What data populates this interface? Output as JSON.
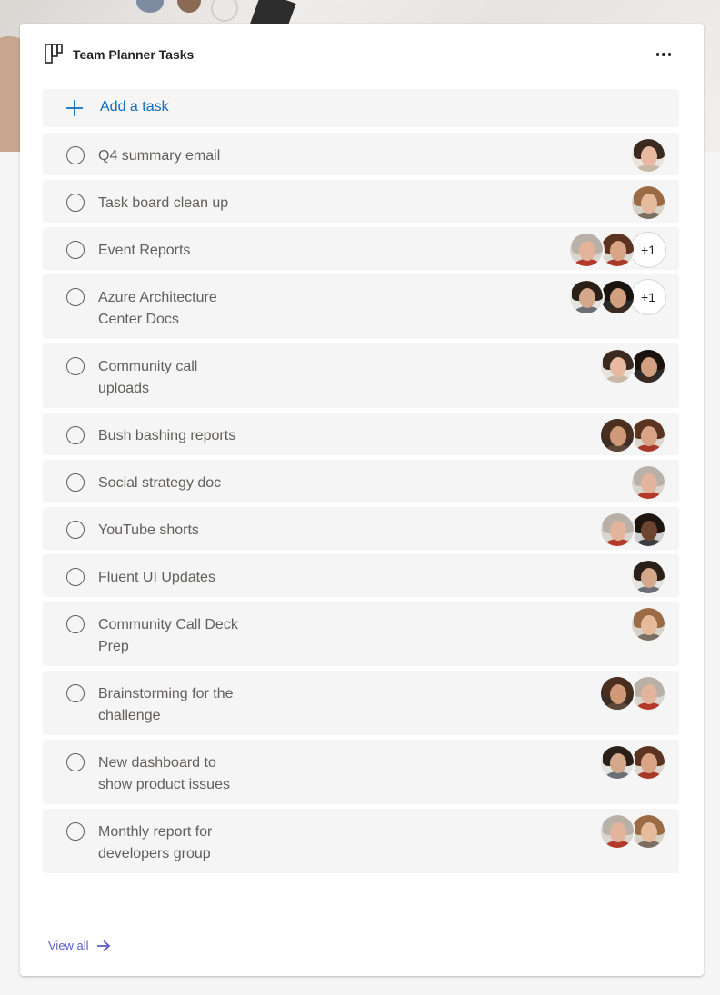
{
  "card": {
    "title": "Team Planner Tasks",
    "add_task_label": "Add a task",
    "view_all_label": "View all",
    "icons": {
      "app": "planner-board-icon",
      "more": "more-options-icon",
      "add": "plus-icon",
      "view_all": "arrow-right-icon"
    }
  },
  "colors": {
    "accent_blue": "#0f6cbd",
    "link_purple": "#5b5fc7",
    "row_bg": "#f5f5f5",
    "text_gray": "#605e5c"
  },
  "tasks": [
    {
      "title": "Q4 summary email",
      "assignees": [
        "a1"
      ],
      "overflow": ""
    },
    {
      "title": "Task board clean up",
      "assignees": [
        "a2"
      ],
      "overflow": ""
    },
    {
      "title": "Event Reports",
      "assignees": [
        "a3",
        "a4"
      ],
      "overflow": "+1"
    },
    {
      "title": "Azure Architecture Center Docs",
      "assignees": [
        "a5",
        "a6"
      ],
      "overflow": "+1"
    },
    {
      "title": "Community call uploads",
      "assignees": [
        "a1",
        "a6"
      ],
      "overflow": ""
    },
    {
      "title": "Bush bashing reports",
      "assignees": [
        "a7",
        "a4"
      ],
      "overflow": ""
    },
    {
      "title": "Social strategy doc",
      "assignees": [
        "a3"
      ],
      "overflow": ""
    },
    {
      "title": "YouTube shorts",
      "assignees": [
        "a3",
        "a8"
      ],
      "overflow": ""
    },
    {
      "title": "Fluent UI Updates",
      "assignees": [
        "a5"
      ],
      "overflow": ""
    },
    {
      "title": "Community Call Deck Prep",
      "assignees": [
        "a2"
      ],
      "overflow": ""
    },
    {
      "title": "Brainstorming for the challenge",
      "assignees": [
        "a7",
        "a3"
      ],
      "overflow": ""
    },
    {
      "title": "New dashboard to show product issues",
      "assignees": [
        "a5",
        "a4"
      ],
      "overflow": ""
    },
    {
      "title": "Monthly report for developers group",
      "assignees": [
        "a3",
        "a2"
      ],
      "overflow": ""
    }
  ],
  "avatar_palettes": {
    "a1": {
      "bg": "#e9e4df",
      "hair": "#3b2a20",
      "face": "#e8b9a0",
      "body": "#c9b8a8"
    },
    "a2": {
      "bg": "#d8d2c6",
      "hair": "#9a6b45",
      "face": "#e5bb9c",
      "body": "#7a6f62"
    },
    "a3": {
      "bg": "#d9d5cf",
      "hair": "#b9b0a8",
      "face": "#e2b49b",
      "body": "#b33a2a"
    },
    "a4": {
      "bg": "#dcd7cf",
      "hair": "#5a3420",
      "face": "#d9a485",
      "body": "#a83a2c"
    },
    "a5": {
      "bg": "#e3e3df",
      "hair": "#2b2018",
      "face": "#d4a88a",
      "body": "#6b6f78"
    },
    "a6": {
      "bg": "#2a2a2a",
      "hair": "#1a120c",
      "face": "#d2a07e",
      "body": "#3a2a22"
    },
    "a7": {
      "bg": "#3b2d24",
      "hair": "#4a2e1e",
      "face": "#d09a78",
      "body": "#5c4638"
    },
    "a8": {
      "bg": "#cfcfcf",
      "hair": "#1e1510",
      "face": "#6b4530",
      "body": "#3c3c42"
    }
  }
}
